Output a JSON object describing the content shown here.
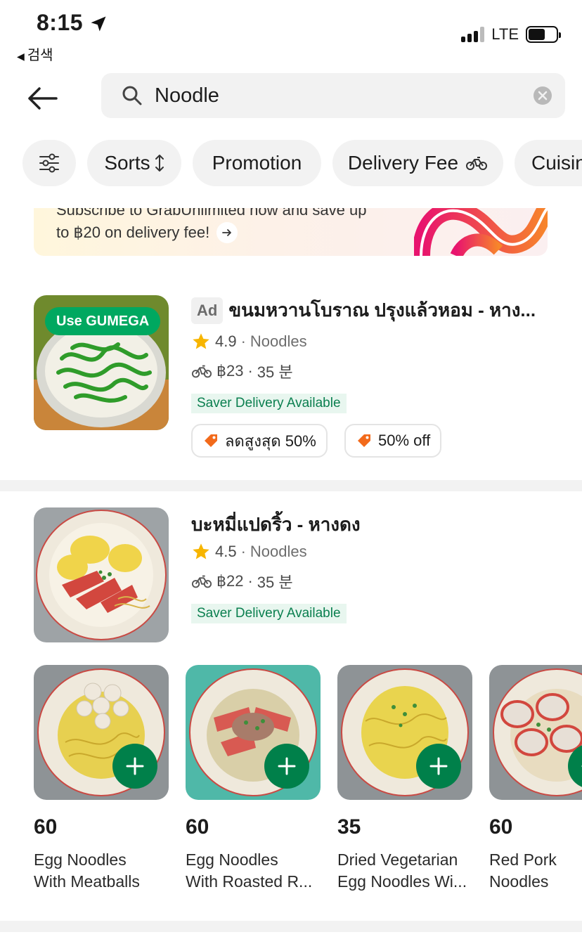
{
  "status_bar": {
    "time": "8:15",
    "back_label": "검색",
    "network": "LTE"
  },
  "search": {
    "query": "Noodle"
  },
  "filters": [
    {
      "label": "Sorts"
    },
    {
      "label": "Promotion"
    },
    {
      "label": "Delivery Fee"
    },
    {
      "label": "Cuisin"
    }
  ],
  "banner": {
    "line1": "Subscribe to GrabUnlimited now and save up",
    "line2": "to ฿20 on delivery fee!"
  },
  "restaurants": [
    {
      "ad_label": "Ad",
      "name": "ขนมหวานโบราณ ปรุงแล้วหอม - หาง...",
      "promo_badge": "Use GUMEGA",
      "rating": "4.9",
      "cuisine": "Noodles",
      "delivery_fee": "฿23",
      "time": "35 분",
      "saver": "Saver Delivery Available",
      "offers": [
        "ลดสูงสุด 50%",
        "50% off"
      ]
    },
    {
      "name": "บะหมี่แปดริ้ว - หางดง",
      "rating": "4.5",
      "cuisine": "Noodles",
      "delivery_fee": "฿22",
      "time": "35 분",
      "saver": "Saver Delivery Available",
      "dishes": [
        {
          "price": "60",
          "name_line1": "Egg Noodles",
          "name_line2": "With Meatballs"
        },
        {
          "price": "60",
          "name_line1": "Egg Noodles",
          "name_line2": "With Roasted R..."
        },
        {
          "price": "35",
          "name_line1": "Dried Vegetarian",
          "name_line2": "Egg Noodles Wi..."
        },
        {
          "price": "60",
          "name_line1": "Red Pork",
          "name_line2": "Noodles"
        }
      ]
    }
  ],
  "colors": {
    "brand_green": "#00a860",
    "add_button": "#00804a",
    "saver_bg": "#e8f6ef",
    "saver_text": "#0a7f4f",
    "offer_icon": "#f26a1b",
    "star": "#f7b500"
  }
}
